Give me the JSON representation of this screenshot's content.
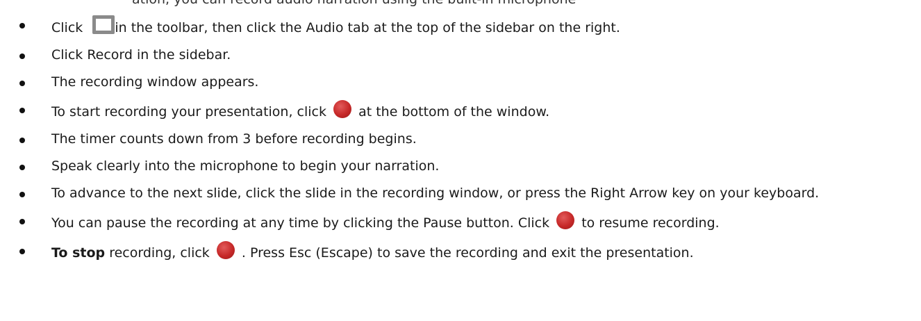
{
  "top_fragment": "ation, you can record audio narration using the built-in microphone",
  "steps": [
    {
      "pre": "Click ",
      "icon": "toolbar-slide-icon",
      "post": "in the toolbar, then click the Audio tab at the top of the sidebar on the right."
    },
    {
      "text": "Click Record in the sidebar."
    },
    {
      "text": "The recording window appears."
    },
    {
      "pre": "To start recording your presentation, click ",
      "icon": "record-icon",
      "post": " at the bottom of the window."
    },
    {
      "text": "The timer counts down from 3 before recording begins."
    },
    {
      "text": "Speak clearly into the microphone to begin your narration."
    },
    {
      "text": "To advance to the next slide, click the slide in the recording window, or press the Right Arrow key on your keyboard."
    },
    {
      "pre": "You can pause the recording at any time by clicking the Pause button. Click ",
      "icon": "record-icon",
      "post": " to resume recording."
    },
    {
      "bold": "To stop",
      "pre": " recording, click ",
      "icon": "record-icon",
      "post": " . Press Esc (Escape) to save the recording and exit the presentation."
    }
  ],
  "colors": {
    "record_red": "#c62828",
    "toolbar_icon_gray": "#8a8a8a",
    "text": "#1a1a1a"
  }
}
